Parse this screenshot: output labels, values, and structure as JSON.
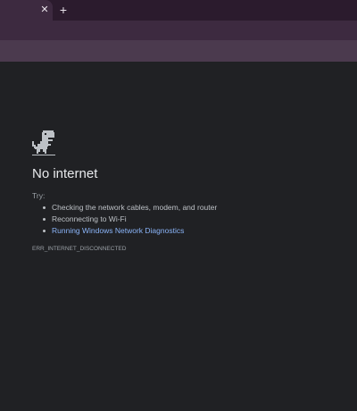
{
  "tabstrip": {
    "close_glyph": "✕",
    "new_tab_glyph": "+"
  },
  "error_page": {
    "icon": "dino-icon",
    "title": "No internet",
    "try_label": "Try:",
    "suggestions": [
      "Checking the network cables, modem, and router",
      "Reconnecting to Wi-Fi",
      "Running Windows Network Diagnostics"
    ],
    "error_code": "ERR_INTERNET_DISCONNECTED"
  },
  "colors": {
    "tabstrip_bg": "#2b1b2d",
    "toolbar_bg": "#3d2a40",
    "bookmarks_bg": "#4b3a4e",
    "page_bg": "#202124",
    "link": "#8ab4f8"
  }
}
